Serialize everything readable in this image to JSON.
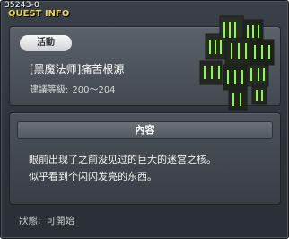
{
  "window": {
    "quest_id": "35243-0",
    "title": "QUEST INFO"
  },
  "quest": {
    "category_label": "活動",
    "name": "[黑魔法师]痛苦根源",
    "level_label": "建議等級:",
    "level_range": "200～204"
  },
  "content": {
    "header": "內容",
    "lines": [
      "眼前出现了之前没见过的巨大的迷宫之核。",
      "似乎看到个闪闪发亮的东西。"
    ]
  },
  "status": {
    "label": "狀態:",
    "value": "可開始"
  },
  "colors": {
    "title": "#e8d25a",
    "glow": "#8dff3a"
  },
  "icon": "labyrinth-core-icon"
}
